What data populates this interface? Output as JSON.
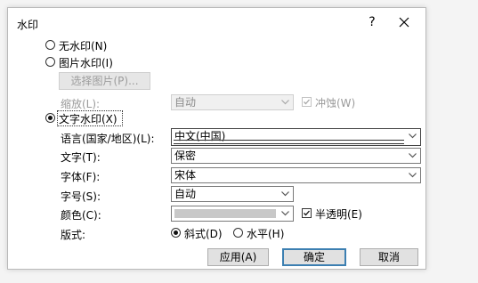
{
  "dialog": {
    "title": "水印",
    "help": "?"
  },
  "options": {
    "no_watermark": "无水印(N)",
    "picture_watermark": "图片水印(I)",
    "select_picture": "选择图片(P)...",
    "scale_label": "缩放(L):",
    "scale_value": "自动",
    "washout_label": "冲蚀(W)",
    "text_watermark": "文字水印(X)"
  },
  "text_settings": {
    "language_label": "语言(国家/地区)(L):",
    "language_value": "中文(中国)",
    "text_label": "文字(T):",
    "text_value": "保密",
    "font_label": "字体(F):",
    "font_value": "宋体",
    "size_label": "字号(S):",
    "size_value": "自动",
    "color_label": "颜色(C):",
    "color_value": "",
    "semitransparent_label": "半透明(E)",
    "layout_label": "版式:",
    "diagonal_label": "斜式(D)",
    "horizontal_label": "水平(H)"
  },
  "buttons": {
    "apply": "应用(A)",
    "ok": "确定",
    "cancel": "取消"
  },
  "state": {
    "selected_type": "text",
    "layout": "diagonal",
    "semitransparent": true,
    "washout": true
  }
}
